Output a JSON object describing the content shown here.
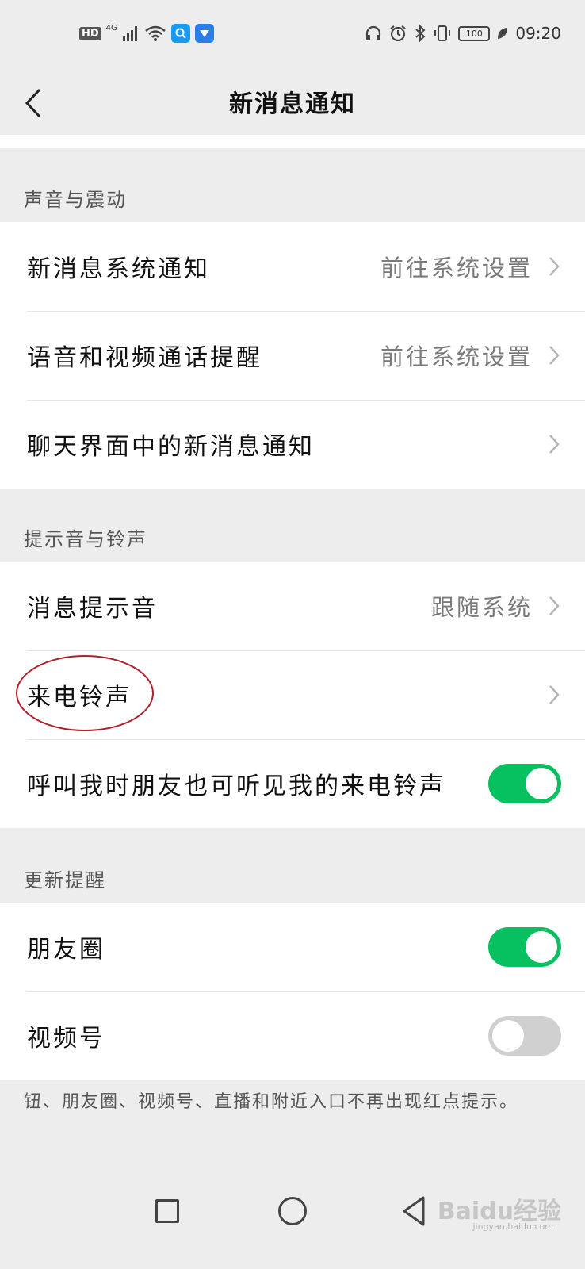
{
  "status_bar": {
    "hd": "HD",
    "network": "4G",
    "battery": "100",
    "time": "09:20"
  },
  "header": {
    "title": "新消息通知"
  },
  "sections": {
    "sound": {
      "label": "声音与震动",
      "items": [
        {
          "label": "新消息系统通知",
          "value": "前往系统设置"
        },
        {
          "label": "语音和视频通话提醒",
          "value": "前往系统设置"
        },
        {
          "label": "聊天界面中的新消息通知",
          "value": ""
        }
      ]
    },
    "ringtone": {
      "label": "提示音与铃声",
      "items": [
        {
          "label": "消息提示音",
          "value": "跟随系统"
        },
        {
          "label": "来电铃声",
          "value": ""
        },
        {
          "label": "呼叫我时朋友也可听见我的来电铃声",
          "toggle": true
        }
      ]
    },
    "update": {
      "label": "更新提醒",
      "items": [
        {
          "label": "朋友圈",
          "toggle": true
        },
        {
          "label": "视频号",
          "toggle": false
        }
      ]
    }
  },
  "footer_note": "钮、朋友圈、视频号、直播和附近入口不再出现红点提示。",
  "watermark": {
    "brand": "Baidu经验",
    "url": "jingyan.baidu.com"
  },
  "colors": {
    "accent": "#07c160",
    "highlight": "#b0202a",
    "background": "#ededed"
  },
  "icons": [
    "hd-icon",
    "signal-icon",
    "wifi-icon",
    "search-app-icon",
    "feishu-app-icon",
    "headphones-icon",
    "alarm-icon",
    "bluetooth-icon",
    "vibrate-icon",
    "battery-icon",
    "leaf-icon",
    "back-chevron-icon",
    "chevron-right-icon",
    "square-nav-icon",
    "circle-nav-icon",
    "triangle-nav-icon"
  ]
}
